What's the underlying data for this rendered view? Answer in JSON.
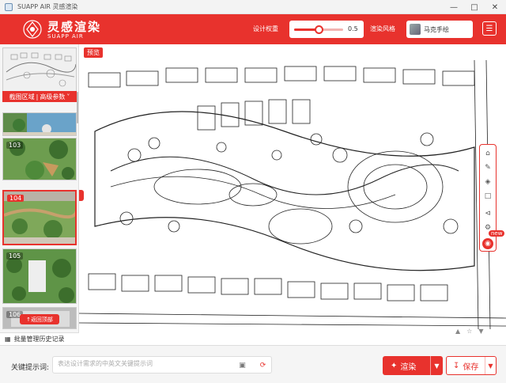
{
  "window": {
    "title": "SUAPP AIR 灵感渲染"
  },
  "header": {
    "brand_cn": "灵感渲染",
    "brand_en": "SUAPP AIR",
    "design_weight_label": "设计权重",
    "design_weight_value": "0.5",
    "design_weight_fraction": 0.5,
    "style_label": "渲染风格",
    "style_value": "马克手绘"
  },
  "sidebar": {
    "upload_label": "截图区域",
    "params_label": "高级参数",
    "items": [
      {
        "num": "103"
      },
      {
        "num": "104"
      },
      {
        "num": "105"
      },
      {
        "num": "106"
      }
    ],
    "back_top": "返回顶部",
    "history": "批量管理历史记录"
  },
  "canvas": {
    "tag": "预览",
    "new_badge": "new"
  },
  "bottom": {
    "keyword_label": "关键提示词:",
    "keyword_placeholder": "表达设计需求的中英文关键提示词",
    "render": "渲染",
    "save": "保存"
  },
  "colors": {
    "accent": "#e8322d"
  }
}
